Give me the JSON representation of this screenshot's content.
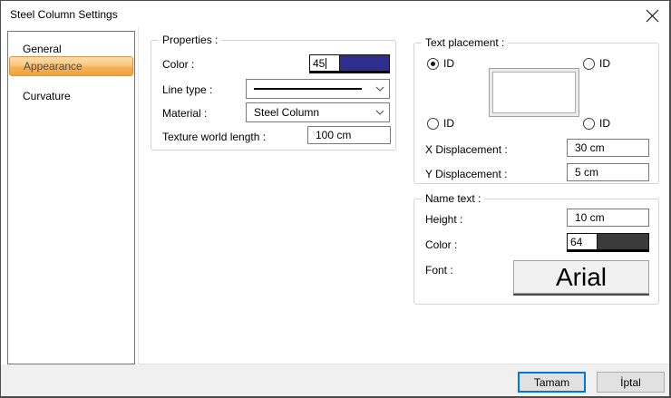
{
  "window": {
    "title": "Steel Column Settings"
  },
  "sidebar": {
    "items": [
      {
        "label": "General",
        "selected": false
      },
      {
        "label": "Appearance",
        "selected": true
      },
      {
        "label": "Curvature",
        "selected": false
      }
    ]
  },
  "properties": {
    "group_label": "Properties :",
    "color_label": "Color :",
    "color_value": "45",
    "color_swatch_hex": "#2e2e8e",
    "line_type_label": "Line type :",
    "material_label": "Material :",
    "material_value": "Steel Column",
    "texture_label": "Texture world length :",
    "texture_value": "100 cm"
  },
  "text_placement": {
    "group_label": "Text placement :",
    "radios": [
      {
        "label": "ID",
        "position": "top-left",
        "selected": true
      },
      {
        "label": "ID",
        "position": "top-right",
        "selected": false
      },
      {
        "label": "ID",
        "position": "bottom-left",
        "selected": false
      },
      {
        "label": "ID",
        "position": "bottom-right",
        "selected": false
      }
    ],
    "x_label": "X Displacement :",
    "x_value": "30 cm",
    "y_label": "Y Displacement :",
    "y_value": "5 cm"
  },
  "name_text": {
    "group_label": "Name text :",
    "height_label": "Height :",
    "height_value": "10 cm",
    "color_label": "Color :",
    "color_value": "64",
    "color_swatch_hex": "#3b3b3b",
    "font_label": "Font :",
    "font_value": "Arial"
  },
  "footer": {
    "ok_label": "Tamam",
    "cancel_label": "İptal"
  },
  "colors": {
    "accent_blue": "#0078d7",
    "selection_orange_top": "#fdddab",
    "selection_orange_bottom": "#efa13d",
    "properties_color_swatch": "#2e2e8e",
    "name_color_swatch": "#3b3b3b",
    "footer_bg": "#f0f0f0"
  }
}
